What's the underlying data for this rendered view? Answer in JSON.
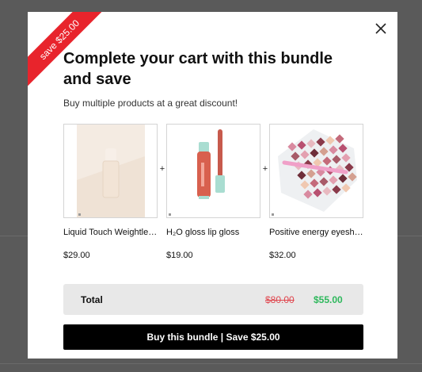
{
  "modal": {
    "ribbon_text": "save $25.00",
    "title": "Complete your cart with this bundle and save",
    "subtitle": "Buy multiple products at a great discount!",
    "plus_sign": "+"
  },
  "products": [
    {
      "name": "Liquid Touch Weightless Foundation",
      "price": "$29.00",
      "icon": "foundation-bottle-image"
    },
    {
      "name": "H₂O gloss lip gloss",
      "price": "$19.00",
      "icon": "lip-gloss-image"
    },
    {
      "name": "Positive energy eyeshadow palette",
      "price": "$32.00",
      "icon": "eyeshadow-palette-image"
    }
  ],
  "total": {
    "label": "Total",
    "original_price": "$80.00",
    "discounted_price": "$55.00"
  },
  "buy_button": {
    "label": "Buy this bundle | Save $25.00"
  },
  "colors": {
    "ribbon": "#e8242c",
    "strike_price": "#e0464e",
    "sale_price": "#2eb85c",
    "button": "#000000"
  }
}
